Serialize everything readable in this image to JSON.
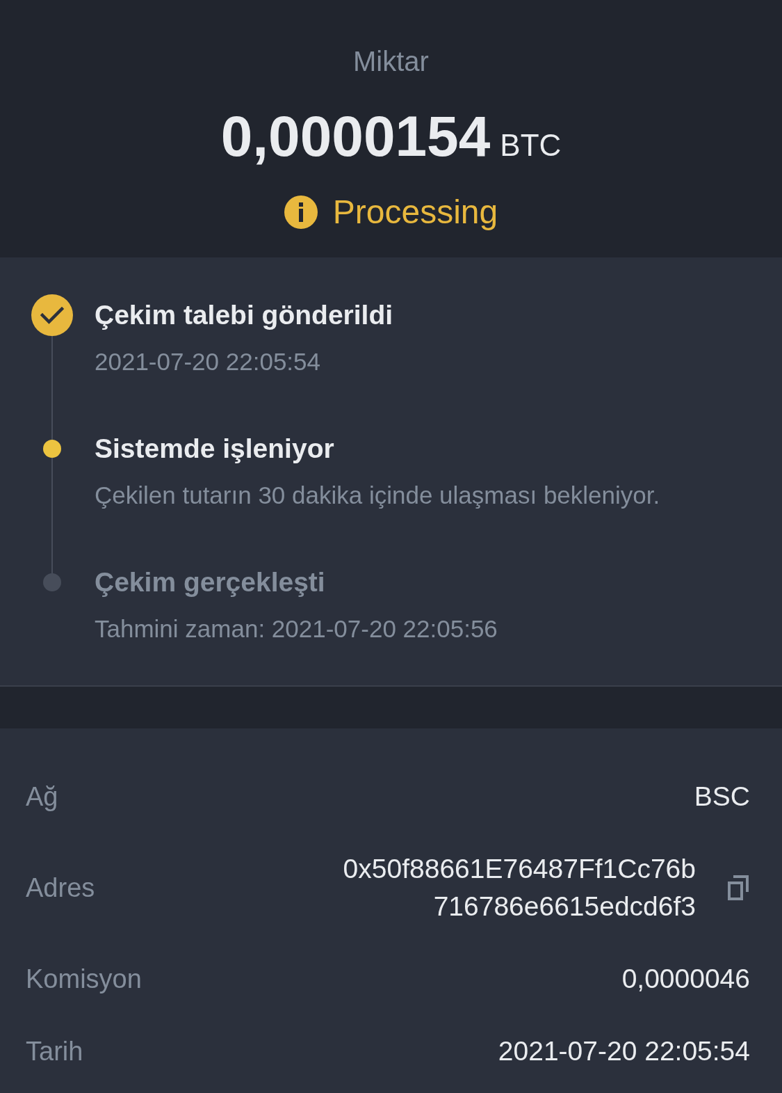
{
  "header": {
    "label": "Miktar",
    "amount": "0,0000154",
    "currency": "BTC",
    "status": {
      "kind": "processing",
      "label": "Processing"
    }
  },
  "steps": [
    {
      "kind": "done",
      "title": "Çekim talebi gönderildi",
      "detail": "2021-07-20 22:05:54"
    },
    {
      "kind": "current",
      "title": "Sistemde işleniyor",
      "detail": "Çekilen tutarın 30 dakika içinde ulaşması bekleniyor."
    },
    {
      "kind": "pending",
      "title": "Çekim gerçekleşti",
      "detail": "Tahmini zaman: 2021-07-20 22:05:56"
    }
  ],
  "details": [
    {
      "label": "Ağ",
      "value_lines": [
        "BSC"
      ],
      "copyable": false
    },
    {
      "label": "Adres",
      "value_lines": [
        "0x50f88661E76487Ff1Cc76b",
        "716786e6615edcd6f3"
      ],
      "copyable": true
    },
    {
      "label": "Komisyon",
      "value_lines": [
        "0,0000046"
      ],
      "copyable": false
    },
    {
      "label": "Tarih",
      "value_lines": [
        "2021-07-20 22:05:54"
      ],
      "copyable": false
    }
  ]
}
